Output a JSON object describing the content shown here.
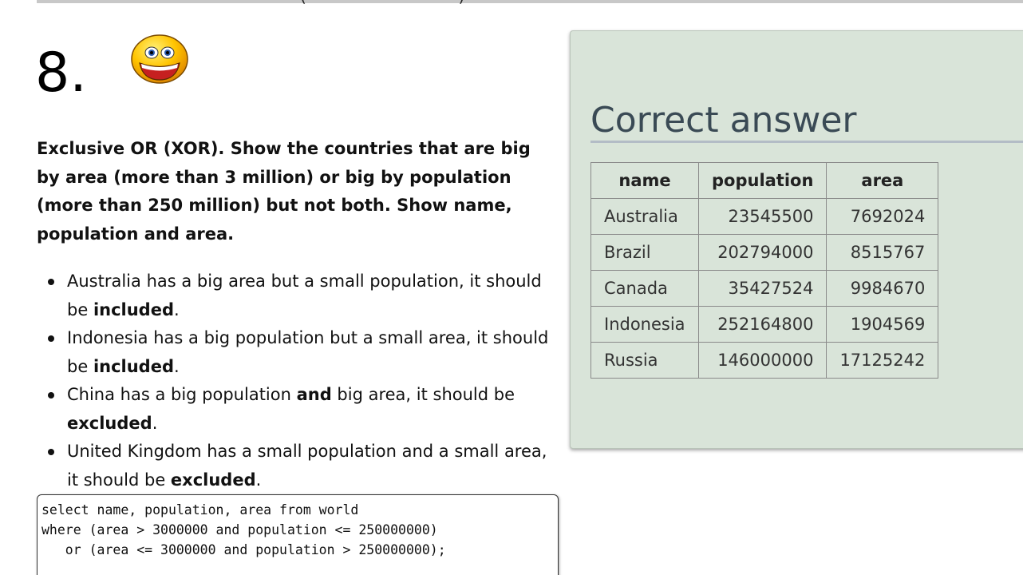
{
  "header": {
    "partial_text": "(                              )"
  },
  "question": {
    "number": "8.",
    "prompt": "Exclusive OR (XOR). Show the countries that are big by area (more than 3 million) or big by population (more than 250 million) but not both. Show name, population and area.",
    "bullets": [
      {
        "pre": "Australia has a big area but a small population, it should be ",
        "bold": "included",
        "post": "."
      },
      {
        "pre": "Indonesia has a big population but a small area, it should be ",
        "bold": "included",
        "post": "."
      },
      {
        "pre": "China has a big population ",
        "bold_mid": "and",
        "mid_post": " big area, it should be ",
        "bold": "excluded",
        "post": "."
      },
      {
        "pre": "United Kingdom has a small population and a small area, it should be ",
        "bold": "excluded",
        "post": "."
      }
    ]
  },
  "sql": {
    "lines": [
      "select name, population, area from world",
      "where (area > 3000000 and population <= 250000000)",
      "   or (area <= 3000000 and population > 250000000);"
    ]
  },
  "answer": {
    "title": "Correct answer",
    "columns": [
      "name",
      "population",
      "area"
    ],
    "rows": [
      [
        "Australia",
        "23545500",
        "7692024"
      ],
      [
        "Brazil",
        "202794000",
        "8515767"
      ],
      [
        "Canada",
        "35427524",
        "9984670"
      ],
      [
        "Indonesia",
        "252164800",
        "1904569"
      ],
      [
        "Russia",
        "146000000",
        "17125242"
      ]
    ]
  },
  "icons": {
    "smiley": "grinning-smiley-icon"
  },
  "colors": {
    "panel_bg": "#d9e4d9",
    "title_color": "#3a4a55",
    "smiley_yellow": "#ffc400"
  }
}
